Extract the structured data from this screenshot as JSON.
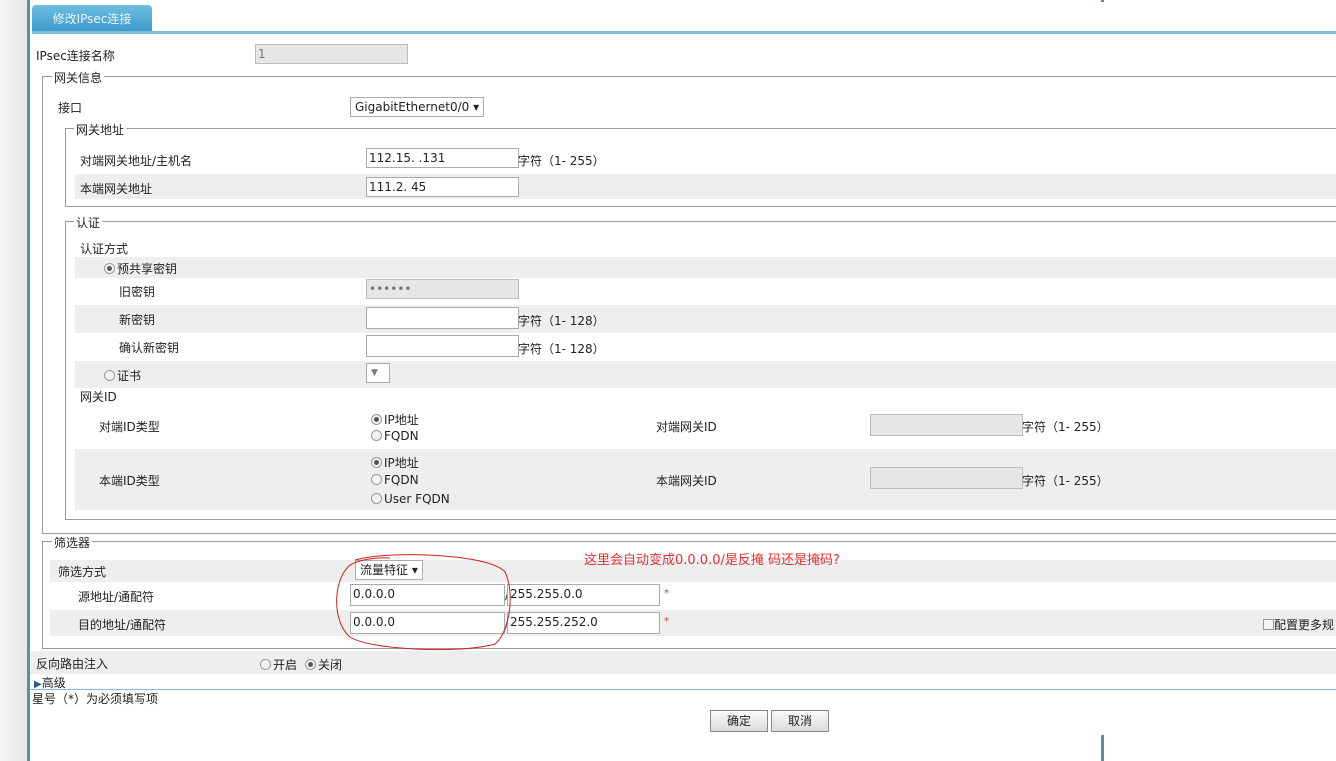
{
  "tab": {
    "title": "修改IPsec连接"
  },
  "name": {
    "label": "IPsec连接名称",
    "value": "1"
  },
  "gateway": {
    "legend": "网关信息",
    "iface_label": "接口",
    "iface_value": "GigabitEthernet0/0",
    "addr": {
      "legend": "网关地址",
      "peer_label": "对端网关地址/主机名",
      "peer_value": "112.15.    .131",
      "peer_hint": "字符（1- 255）",
      "local_label": "本端网关地址",
      "local_value": "111.2.     45"
    },
    "auth": {
      "legend": "认证",
      "method_label": "认证方式",
      "psk_label": "预共享密钥",
      "old_key_label": "旧密钥",
      "old_key_value": "••••••",
      "new_key_label": "新密钥",
      "new_key_hint": "字符（1- 128）",
      "confirm_key_label": "确认新密钥",
      "confirm_key_hint": "字符（1- 128）",
      "cert_label": "证书",
      "gwid_label": "网关ID",
      "peer_id_type_label": "对端ID类型",
      "peer_id_opts": [
        "IP地址",
        "FQDN"
      ],
      "peer_id_label": "对端网关ID",
      "peer_id_hint": "字符（1- 255）",
      "local_id_type_label": "本端ID类型",
      "local_id_opts": [
        "IP地址",
        "FQDN",
        "User FQDN"
      ],
      "local_id_label": "本端网关ID",
      "local_id_hint": "字符（1- 255）"
    }
  },
  "filter": {
    "legend": "筛选器",
    "mode_label": "筛选方式",
    "mode_value": "流量特征",
    "src_label": "源地址/通配符",
    "src_addr": "0.0.0.0",
    "src_mask": "255.255.0.0",
    "dst_label": "目的地址/通配符",
    "dst_addr": "0.0.0.0",
    "dst_mask": "255.255.252.0",
    "star": "*",
    "more_rules": "配置更多规",
    "annotation": "这里会自动变成0.0.0.0/是反掩 码还是掩码?"
  },
  "rri": {
    "label": "反向路由注入",
    "on": "开启",
    "off": "关闭"
  },
  "advanced": "高级",
  "required_note": "星号（*）为必须填写项",
  "buttons": {
    "ok": "确定",
    "cancel": "取消"
  },
  "sep": "/"
}
